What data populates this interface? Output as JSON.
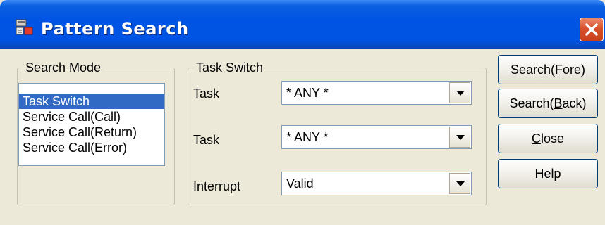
{
  "window": {
    "title": "Pattern Search",
    "icon": "pattern-search-app-icon",
    "close_icon": "close-icon"
  },
  "search_mode": {
    "title": "Search Mode",
    "items": [
      "Task Switch",
      "Service Call(Call)",
      "Service Call(Return)",
      "Service Call(Error)"
    ],
    "selected": "Task Switch"
  },
  "task_switch": {
    "title": "Task Switch",
    "fields": [
      {
        "label": "Task",
        "value": "* ANY *"
      },
      {
        "label": "Task",
        "value": "* ANY *"
      },
      {
        "label": "Interrupt",
        "value": "Valid"
      }
    ]
  },
  "buttons": {
    "search_fore": {
      "before": "Search(",
      "mnemonic": "F",
      "after": "ore)"
    },
    "search_back": {
      "before": "Search(",
      "mnemonic": "B",
      "after": "ack)"
    },
    "close": {
      "before": "",
      "mnemonic": "C",
      "after": "lose"
    },
    "help": {
      "before": "",
      "mnemonic": "H",
      "after": "elp"
    }
  },
  "colors": {
    "titlebar": "#0054e3",
    "selection": "#316ac5",
    "dialog_bg": "#ece9d8",
    "close_button": "#d9512c"
  }
}
